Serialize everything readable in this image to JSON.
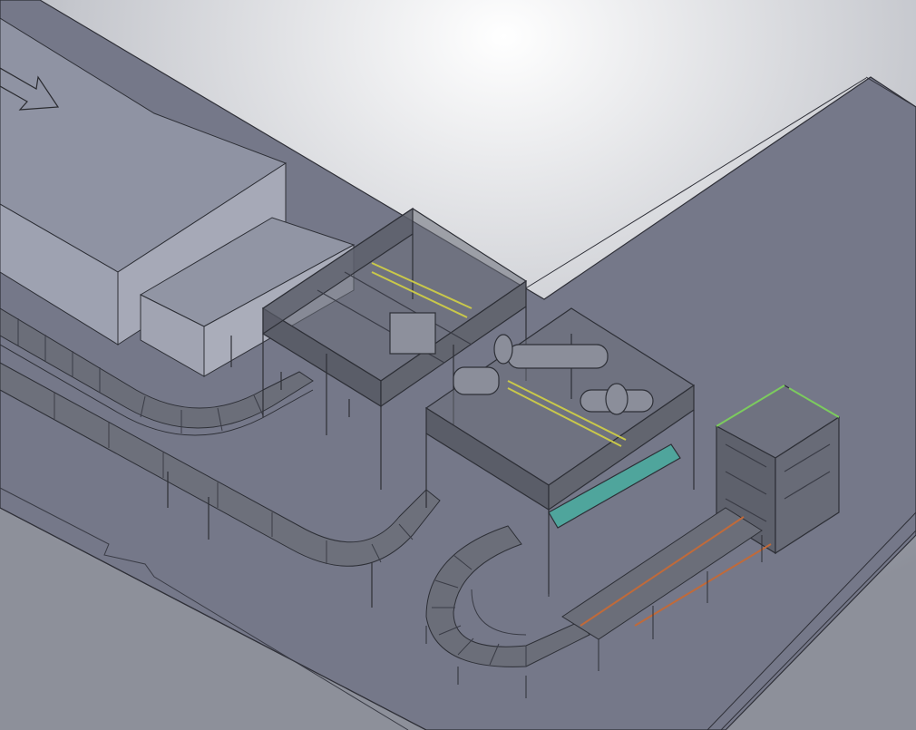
{
  "scene": {
    "kind": "cad-3d-isometric-render",
    "subject": "conveyor-packaging-line",
    "palette": {
      "background_light": "#ffffff",
      "background_dark": "#8c8f99",
      "floor": "#757889",
      "floor_edge": "#2f3038",
      "block_top": "#8f93a3",
      "block_side": "#9ea2b1",
      "frame": "#5a5d68",
      "frame_dark": "#2d2f36",
      "conveyor": "#6b6e79",
      "accent_yellow": "#c9c84a",
      "accent_teal": "#4fa59c",
      "accent_green": "#7ccb5e",
      "accent_orange": "#c06a3a"
    },
    "components": [
      "floor-slab",
      "building-block",
      "arrow-marker",
      "gantry-frame-left",
      "gantry-frame-right",
      "curved-conveyor-upper",
      "curved-conveyor-middle",
      "curved-conveyor-lower",
      "palletizer-tower",
      "outfeed-conveyor"
    ]
  }
}
